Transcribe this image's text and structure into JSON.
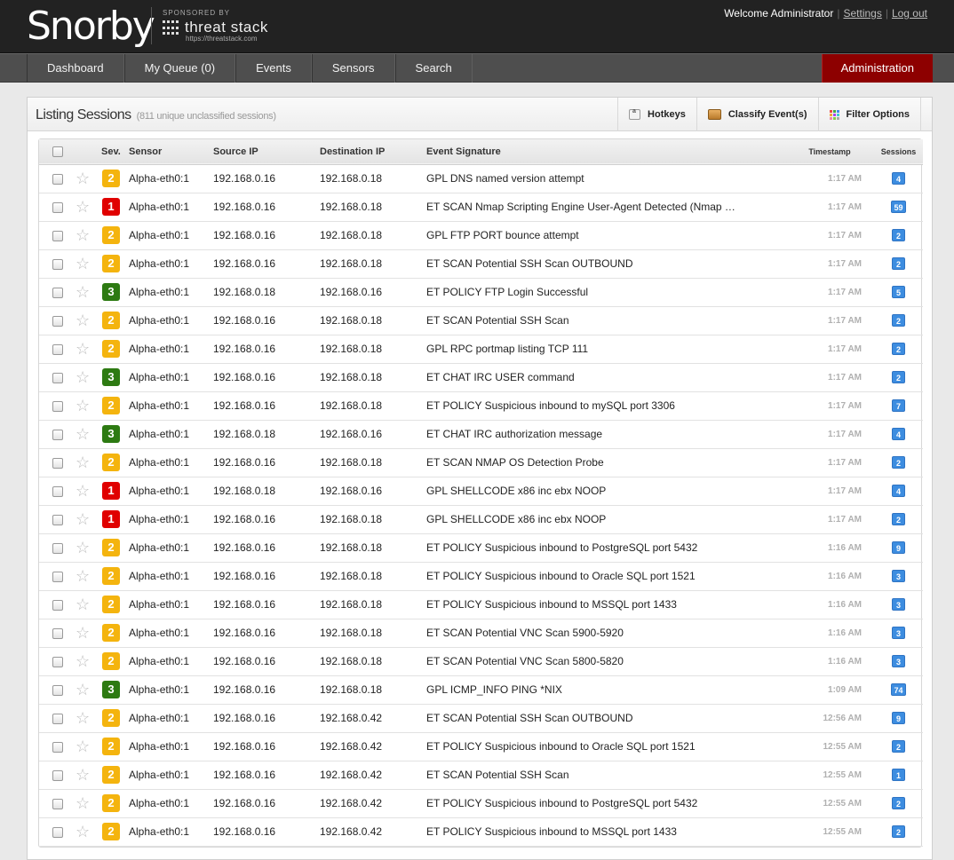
{
  "header": {
    "logo": "Snorby",
    "sponsor_label": "SPONSORED BY",
    "sponsor_name": "threat stack",
    "sponsor_url": "https://threatstack.com",
    "welcome": "Welcome Administrator",
    "settings": "Settings",
    "logout": "Log out"
  },
  "nav": {
    "items": [
      "Dashboard",
      "My Queue (0)",
      "Events",
      "Sensors",
      "Search"
    ],
    "admin": "Administration"
  },
  "panel": {
    "title": "Listing Sessions",
    "subtitle": "(811 unique unclassified sessions)",
    "actions": [
      "Hotkeys",
      "Classify Event(s)",
      "Filter Options"
    ]
  },
  "table": {
    "headers": {
      "sev": "Sev.",
      "sensor": "Sensor",
      "source": "Source IP",
      "dest": "Destination IP",
      "signature": "Event Signature",
      "timestamp": "Timestamp",
      "sessions": "Sessions"
    },
    "rows": [
      {
        "sev": "2",
        "sensor": "Alpha-eth0:1",
        "src": "192.168.0.16",
        "dst": "192.168.0.18",
        "sig": "GPL DNS named version attempt",
        "ts": "1:17 AM",
        "count": "4"
      },
      {
        "sev": "1",
        "sensor": "Alpha-eth0:1",
        "src": "192.168.0.16",
        "dst": "192.168.0.18",
        "sig": "ET SCAN Nmap Scripting Engine User-Agent Detected (Nmap …",
        "ts": "1:17 AM",
        "count": "59"
      },
      {
        "sev": "2",
        "sensor": "Alpha-eth0:1",
        "src": "192.168.0.16",
        "dst": "192.168.0.18",
        "sig": "GPL FTP PORT bounce attempt",
        "ts": "1:17 AM",
        "count": "2"
      },
      {
        "sev": "2",
        "sensor": "Alpha-eth0:1",
        "src": "192.168.0.16",
        "dst": "192.168.0.18",
        "sig": "ET SCAN Potential SSH Scan OUTBOUND",
        "ts": "1:17 AM",
        "count": "2"
      },
      {
        "sev": "3",
        "sensor": "Alpha-eth0:1",
        "src": "192.168.0.18",
        "dst": "192.168.0.16",
        "sig": "ET POLICY FTP Login Successful",
        "ts": "1:17 AM",
        "count": "5"
      },
      {
        "sev": "2",
        "sensor": "Alpha-eth0:1",
        "src": "192.168.0.16",
        "dst": "192.168.0.18",
        "sig": "ET SCAN Potential SSH Scan",
        "ts": "1:17 AM",
        "count": "2"
      },
      {
        "sev": "2",
        "sensor": "Alpha-eth0:1",
        "src": "192.168.0.16",
        "dst": "192.168.0.18",
        "sig": "GPL RPC portmap listing TCP 111",
        "ts": "1:17 AM",
        "count": "2"
      },
      {
        "sev": "3",
        "sensor": "Alpha-eth0:1",
        "src": "192.168.0.16",
        "dst": "192.168.0.18",
        "sig": "ET CHAT IRC USER command",
        "ts": "1:17 AM",
        "count": "2"
      },
      {
        "sev": "2",
        "sensor": "Alpha-eth0:1",
        "src": "192.168.0.16",
        "dst": "192.168.0.18",
        "sig": "ET POLICY Suspicious inbound to mySQL port 3306",
        "ts": "1:17 AM",
        "count": "7"
      },
      {
        "sev": "3",
        "sensor": "Alpha-eth0:1",
        "src": "192.168.0.18",
        "dst": "192.168.0.16",
        "sig": "ET CHAT IRC authorization message",
        "ts": "1:17 AM",
        "count": "4"
      },
      {
        "sev": "2",
        "sensor": "Alpha-eth0:1",
        "src": "192.168.0.16",
        "dst": "192.168.0.18",
        "sig": "ET SCAN NMAP OS Detection Probe",
        "ts": "1:17 AM",
        "count": "2"
      },
      {
        "sev": "1",
        "sensor": "Alpha-eth0:1",
        "src": "192.168.0.18",
        "dst": "192.168.0.16",
        "sig": "GPL SHELLCODE x86 inc ebx NOOP",
        "ts": "1:17 AM",
        "count": "4"
      },
      {
        "sev": "1",
        "sensor": "Alpha-eth0:1",
        "src": "192.168.0.16",
        "dst": "192.168.0.18",
        "sig": "GPL SHELLCODE x86 inc ebx NOOP",
        "ts": "1:17 AM",
        "count": "2"
      },
      {
        "sev": "2",
        "sensor": "Alpha-eth0:1",
        "src": "192.168.0.16",
        "dst": "192.168.0.18",
        "sig": "ET POLICY Suspicious inbound to PostgreSQL port 5432",
        "ts": "1:16 AM",
        "count": "9"
      },
      {
        "sev": "2",
        "sensor": "Alpha-eth0:1",
        "src": "192.168.0.16",
        "dst": "192.168.0.18",
        "sig": "ET POLICY Suspicious inbound to Oracle SQL port 1521",
        "ts": "1:16 AM",
        "count": "3"
      },
      {
        "sev": "2",
        "sensor": "Alpha-eth0:1",
        "src": "192.168.0.16",
        "dst": "192.168.0.18",
        "sig": "ET POLICY Suspicious inbound to MSSQL port 1433",
        "ts": "1:16 AM",
        "count": "3"
      },
      {
        "sev": "2",
        "sensor": "Alpha-eth0:1",
        "src": "192.168.0.16",
        "dst": "192.168.0.18",
        "sig": "ET SCAN Potential VNC Scan 5900-5920",
        "ts": "1:16 AM",
        "count": "3"
      },
      {
        "sev": "2",
        "sensor": "Alpha-eth0:1",
        "src": "192.168.0.16",
        "dst": "192.168.0.18",
        "sig": "ET SCAN Potential VNC Scan 5800-5820",
        "ts": "1:16 AM",
        "count": "3"
      },
      {
        "sev": "3",
        "sensor": "Alpha-eth0:1",
        "src": "192.168.0.16",
        "dst": "192.168.0.18",
        "sig": "GPL ICMP_INFO PING *NIX",
        "ts": "1:09 AM",
        "count": "74"
      },
      {
        "sev": "2",
        "sensor": "Alpha-eth0:1",
        "src": "192.168.0.16",
        "dst": "192.168.0.42",
        "sig": "ET SCAN Potential SSH Scan OUTBOUND",
        "ts": "12:56 AM",
        "count": "9"
      },
      {
        "sev": "2",
        "sensor": "Alpha-eth0:1",
        "src": "192.168.0.16",
        "dst": "192.168.0.42",
        "sig": "ET POLICY Suspicious inbound to Oracle SQL port 1521",
        "ts": "12:55 AM",
        "count": "2"
      },
      {
        "sev": "2",
        "sensor": "Alpha-eth0:1",
        "src": "192.168.0.16",
        "dst": "192.168.0.42",
        "sig": "ET SCAN Potential SSH Scan",
        "ts": "12:55 AM",
        "count": "1"
      },
      {
        "sev": "2",
        "sensor": "Alpha-eth0:1",
        "src": "192.168.0.16",
        "dst": "192.168.0.42",
        "sig": "ET POLICY Suspicious inbound to PostgreSQL port 5432",
        "ts": "12:55 AM",
        "count": "2"
      },
      {
        "sev": "2",
        "sensor": "Alpha-eth0:1",
        "src": "192.168.0.16",
        "dst": "192.168.0.42",
        "sig": "ET POLICY Suspicious inbound to MSSQL port 1433",
        "ts": "12:55 AM",
        "count": "2"
      }
    ]
  },
  "colors": {
    "sev1": "#e00000",
    "sev2": "#f4b40e",
    "sev3": "#2d7a12",
    "admin": "#8d0000",
    "count": "#3d8de0"
  }
}
